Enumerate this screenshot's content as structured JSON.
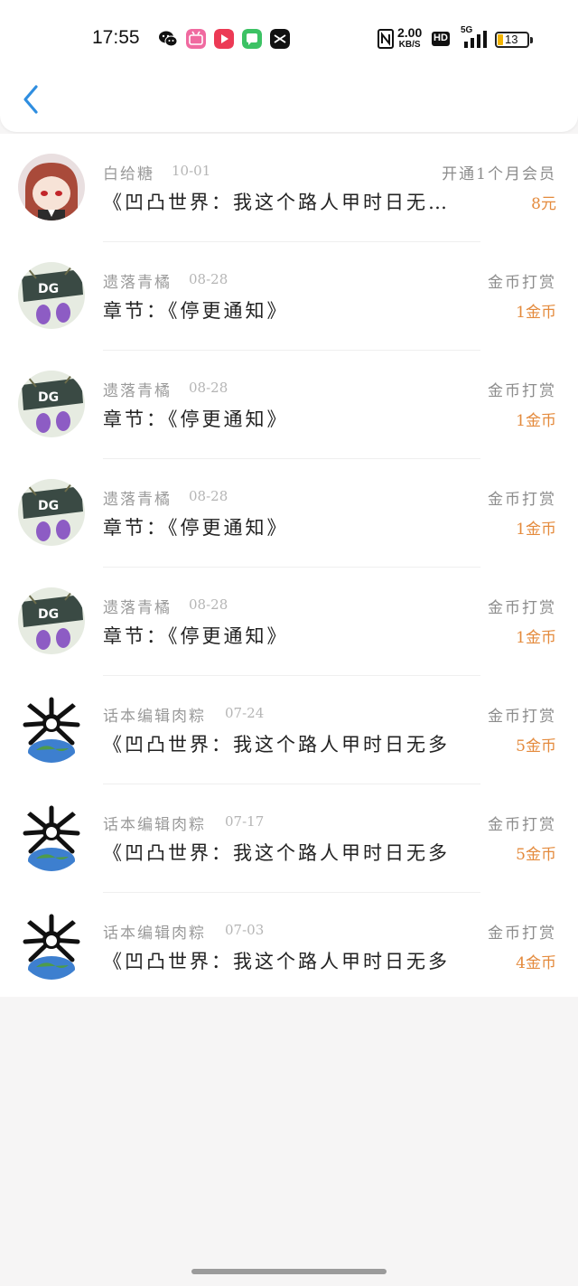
{
  "status_bar": {
    "time": "17:55",
    "net_speed": "2.00",
    "net_unit": "KB/S",
    "hd": "HD",
    "signal": "5G",
    "battery": "13"
  },
  "header": {
    "back_icon": "chevron-left-icon"
  },
  "rewards": [
    {
      "name": "白给糖",
      "date": "10-01",
      "type": "开通1个月会员",
      "title": "《凹凸世界：我这个路人甲时日无…",
      "amount": "8元",
      "avatar": "anime-girl-avatar"
    },
    {
      "name": "遗落青橘",
      "date": "08-28",
      "type": "金币打赏",
      "title": "章节：《停更通知》",
      "amount": "1金币",
      "avatar": "doll-avatar"
    },
    {
      "name": "遗落青橘",
      "date": "08-28",
      "type": "金币打赏",
      "title": "章节：《停更通知》",
      "amount": "1金币",
      "avatar": "doll-avatar"
    },
    {
      "name": "遗落青橘",
      "date": "08-28",
      "type": "金币打赏",
      "title": "章节：《停更通知》",
      "amount": "1金币",
      "avatar": "doll-avatar"
    },
    {
      "name": "遗落青橘",
      "date": "08-28",
      "type": "金币打赏",
      "title": "章节：《停更通知》",
      "amount": "1金币",
      "avatar": "doll-avatar"
    },
    {
      "name": "话本编辑肉粽",
      "date": "07-24",
      "type": "金币打赏",
      "title": "《凹凸世界：我这个路人甲时日无多啊》",
      "amount": "5金币",
      "avatar": "earth-bones-avatar"
    },
    {
      "name": "话本编辑肉粽",
      "date": "07-17",
      "type": "金币打赏",
      "title": "《凹凸世界：我这个路人甲时日无多啊》",
      "amount": "5金币",
      "avatar": "earth-bones-avatar"
    },
    {
      "name": "话本编辑肉粽",
      "date": "07-03",
      "type": "金币打赏",
      "title": "《凹凸世界：我这个路人甲时日无多啊》",
      "amount": "4金币",
      "avatar": "earth-bones-avatar"
    }
  ],
  "colors": {
    "accent": "#2f8ee0",
    "amount": "#e48a3c"
  }
}
